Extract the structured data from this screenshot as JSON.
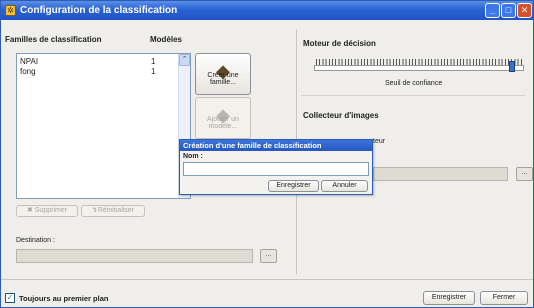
{
  "window": {
    "title": "Configuration de la classification",
    "app_icon": "app-icon"
  },
  "left_panel": {
    "families_header": "Familles de classification",
    "models_header": "Modèles",
    "families": [
      {
        "name": "NPAI",
        "models": "1"
      },
      {
        "name": "fong",
        "models": "1"
      }
    ],
    "create_family_label": "Créer une famille...",
    "add_model_label": "Ajouter un modèle...",
    "delete_label": "Supprimer",
    "reset_label": "Réinitialiser",
    "destination_label": "Destination :",
    "browse_label": "..."
  },
  "right_panel": {
    "decision_engine_title": "Moteur de décision",
    "slider_caption": "Seuil de confiance",
    "image_collector_title": "Collecteur d'images",
    "partial_label": "teur",
    "browse_label": "..."
  },
  "popup": {
    "title": "Création d'une famille de classification",
    "name_label": "Nom :",
    "name_value": "",
    "save_label": "Enregistrer",
    "cancel_label": "Annuler"
  },
  "footer": {
    "always_on_top_label": "Toujours au premier plan",
    "always_on_top_checked": true,
    "save_label": "Enregistrer",
    "close_label": "Fermer"
  },
  "colors": {
    "titlebar": "#2a62d3",
    "window_bg": "#efeeeb",
    "close_button": "#d84f2a"
  }
}
